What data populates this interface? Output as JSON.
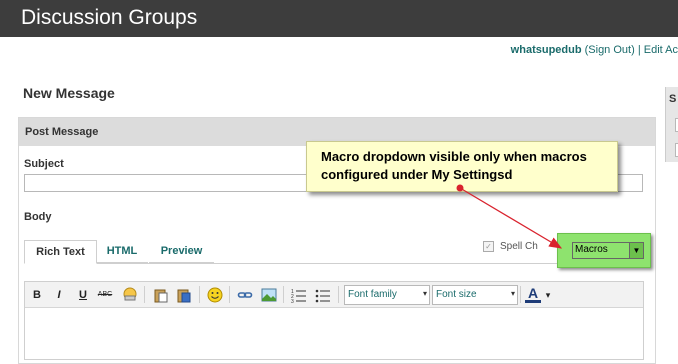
{
  "header": {
    "title": "Discussion Groups"
  },
  "userbar": {
    "username": "whatsupedub",
    "sign_out": "(Sign Out)",
    "separator": "|",
    "edit_account": "Edit Ac"
  },
  "page": {
    "title": "New Message"
  },
  "post": {
    "header": "Post Message",
    "subject_label": "Subject",
    "subject_value": "",
    "body_label": "Body"
  },
  "tabs": [
    {
      "label": "Rich Text"
    },
    {
      "label": "HTML"
    },
    {
      "label": "Preview"
    }
  ],
  "spell": {
    "check_mark": "✓",
    "label": "Spell Ch"
  },
  "macros": {
    "selected": "Macros",
    "arrow": "▼"
  },
  "toolbar": {
    "bold": "B",
    "italic": "I",
    "underline": "U",
    "strike": "ABC",
    "font_family": "Font family",
    "font_size": "Font size",
    "font_color": "A",
    "dropdown_arrow": "▾"
  },
  "right_panel": {
    "label": "S"
  },
  "callout": {
    "text": "Macro dropdown visible only when macros configured under My Settingsd"
  },
  "colors": {
    "accent": "#8ee36e",
    "callout_bg": "#ffffcc",
    "arrow": "#d9232e",
    "link": "#1a6b6b"
  }
}
